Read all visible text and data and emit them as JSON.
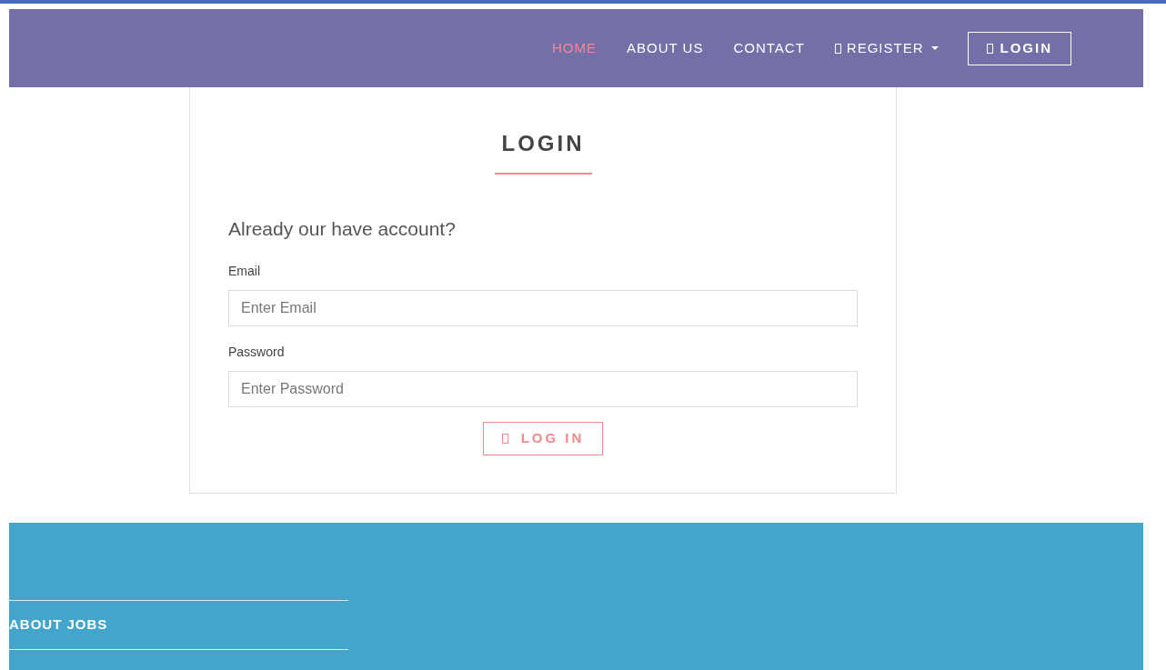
{
  "nav": {
    "items": [
      {
        "label": "HOME",
        "selected": true,
        "kind": "link"
      },
      {
        "label": "ABOUT US",
        "selected": false,
        "kind": "link"
      },
      {
        "label": "CONTACT",
        "selected": false,
        "kind": "link"
      },
      {
        "label": "REGISTER",
        "selected": false,
        "kind": "dropdown"
      }
    ],
    "login_button": "LOGIN"
  },
  "card": {
    "title": "LOGIN",
    "subtitle": "Already our have account?",
    "fields": [
      {
        "label": "Email",
        "placeholder": "Enter Email"
      },
      {
        "label": "Password",
        "placeholder": "Enter Password"
      }
    ],
    "submit": "LOG IN"
  },
  "footer": {
    "heading": "ABOUT JOBS"
  }
}
